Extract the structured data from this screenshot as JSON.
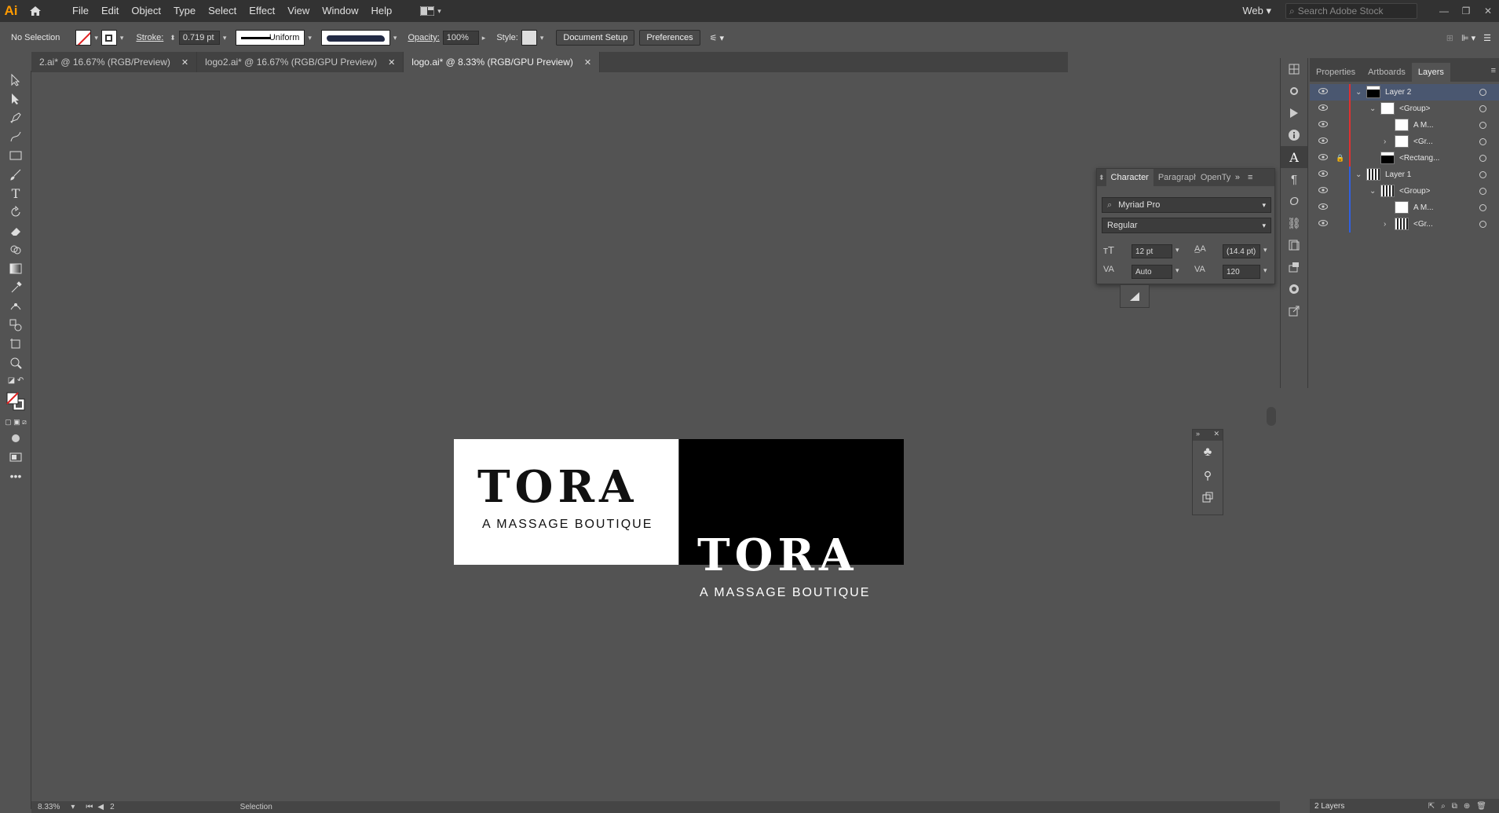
{
  "app": {
    "logo": "Ai"
  },
  "menu": [
    "File",
    "Edit",
    "Object",
    "Type",
    "Select",
    "Effect",
    "View",
    "Window",
    "Help"
  ],
  "workspace": "Web",
  "stock_search_placeholder": "Search Adobe Stock",
  "control_bar": {
    "selection": "No Selection",
    "stroke_label": "Stroke:",
    "stroke_value": "0.719 pt",
    "profile": "Uniform",
    "opacity_label": "Opacity:",
    "opacity_value": "100%",
    "style_label": "Style:",
    "document_setup": "Document Setup",
    "preferences": "Preferences"
  },
  "tabs": [
    {
      "label": "2.ai* @ 16.67% (RGB/Preview)",
      "active": false
    },
    {
      "label": "logo2.ai* @ 16.67% (RGB/GPU Preview)",
      "active": false
    },
    {
      "label": "logo.ai* @ 8.33% (RGB/GPU Preview)",
      "active": true
    }
  ],
  "artwork": {
    "logo_word": "TORA",
    "tagline": "A MASSAGE BOUTIQUE"
  },
  "character_panel": {
    "tabs": [
      "Character",
      "Paragraph",
      "OpenType"
    ],
    "font_family": "Myriad Pro",
    "font_style": "Regular",
    "font_size": "12 pt",
    "leading": "(14.4 pt)",
    "kerning": "Auto",
    "tracking": "120"
  },
  "right_panel": {
    "tabs": [
      "Properties",
      "Artboards",
      "Layers"
    ],
    "layers": [
      {
        "name": "Layer 2",
        "indent": 0,
        "color": "#e03030",
        "selected": true,
        "expanded": true,
        "lock": false,
        "thumb": "black"
      },
      {
        "name": "<Group>",
        "indent": 1,
        "color": "#e03030",
        "selected": false,
        "expanded": true,
        "lock": false,
        "thumb": "white"
      },
      {
        "name": "A M...",
        "indent": 2,
        "color": "#e03030",
        "selected": false,
        "expanded": null,
        "lock": false,
        "thumb": "white"
      },
      {
        "name": "<Gr...",
        "indent": 2,
        "color": "#e03030",
        "selected": false,
        "expanded": false,
        "lock": false,
        "thumb": "white"
      },
      {
        "name": "<Rectang...",
        "indent": 1,
        "color": "#e03030",
        "selected": false,
        "expanded": null,
        "lock": true,
        "thumb": "black"
      },
      {
        "name": "Layer 1",
        "indent": 0,
        "color": "#3060e0",
        "selected": false,
        "expanded": true,
        "lock": false,
        "thumb": "logo"
      },
      {
        "name": "<Group>",
        "indent": 1,
        "color": "#3060e0",
        "selected": false,
        "expanded": true,
        "lock": false,
        "thumb": "logo"
      },
      {
        "name": "A M...",
        "indent": 2,
        "color": "#3060e0",
        "selected": false,
        "expanded": null,
        "lock": false,
        "thumb": "white"
      },
      {
        "name": "<Gr...",
        "indent": 2,
        "color": "#3060e0",
        "selected": false,
        "expanded": false,
        "lock": false,
        "thumb": "logo"
      }
    ],
    "footer": "2 Layers"
  },
  "status": {
    "zoom": "8.33%",
    "artboard": "2",
    "tool": "Selection"
  }
}
